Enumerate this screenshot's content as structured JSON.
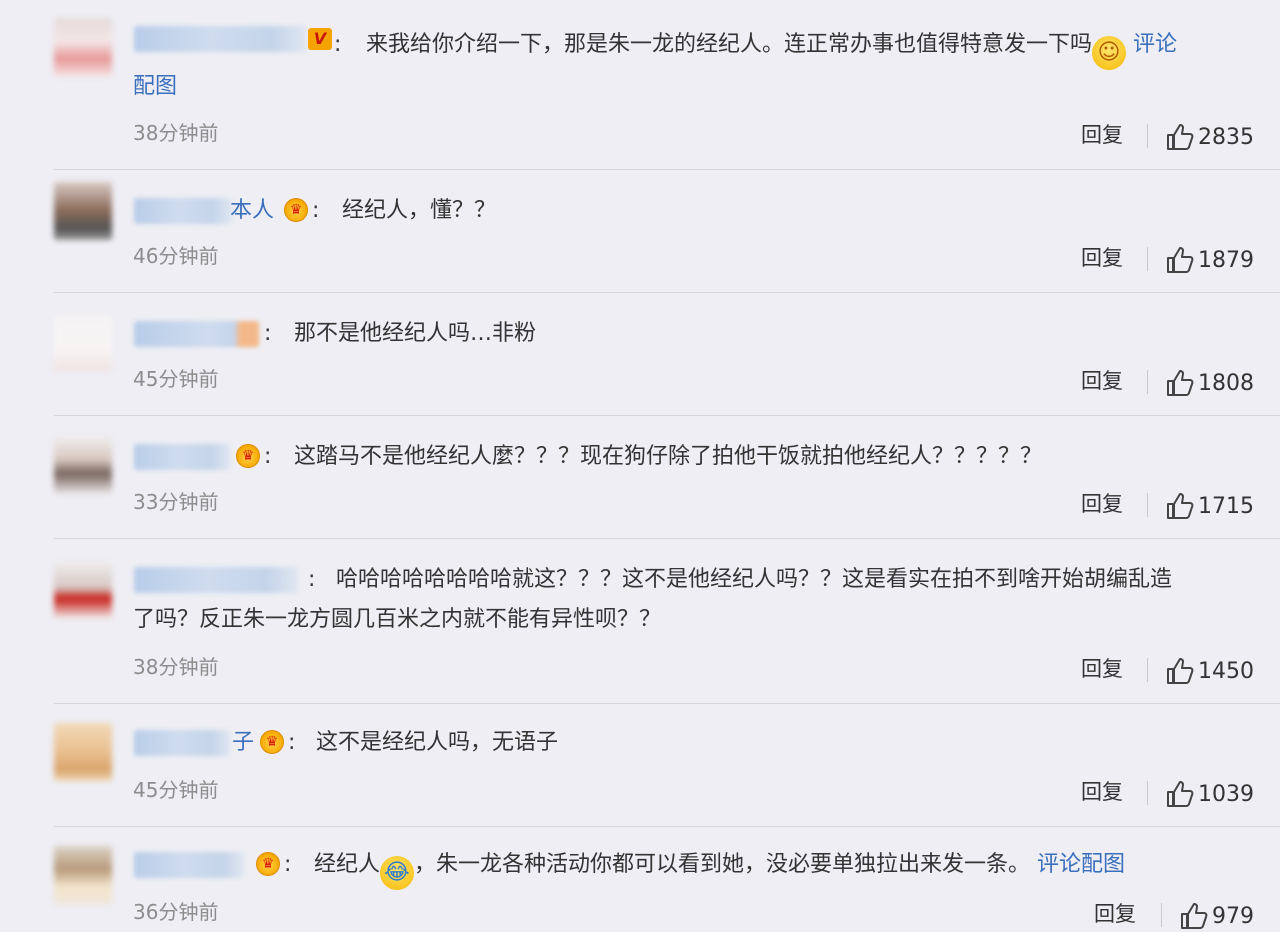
{
  "comments": [
    {
      "name_tail": "",
      "text": "来我给你介绍一下，那是朱一龙的经纪人。连正常办事也值得特意发一下吗",
      "link": "评论",
      "link2": "配图",
      "time": "38分钟前",
      "reply": "回复",
      "likes": "2835"
    },
    {
      "name_tail": "本人",
      "text": "经纪人，懂？？",
      "time": "46分钟前",
      "reply": "回复",
      "likes": "1879"
    },
    {
      "name_tail": "",
      "text": "那不是他经纪人吗…非粉",
      "time": "45分钟前",
      "reply": "回复",
      "likes": "1808"
    },
    {
      "name_tail": "",
      "text": "这踏马不是他经纪人麼？？？现在狗仔除了拍他干饭就拍他经纪人？？？？？",
      "time": "33分钟前",
      "reply": "回复",
      "likes": "1715"
    },
    {
      "name_tail": "",
      "text": "哈哈哈哈哈哈哈哈就这？？？这不是他经纪人吗？？这是看实在拍不到啥开始胡编乱造",
      "text2": "了吗？反正朱一龙方圆几百米之内就不能有异性呗？？",
      "time": "38分钟前",
      "reply": "回复",
      "likes": "1450"
    },
    {
      "name_tail": "子",
      "text": "这不是经纪人吗，无语子",
      "time": "45分钟前",
      "reply": "回复",
      "likes": "1039"
    },
    {
      "name_tail": "",
      "text_a": "经纪人",
      "text_b": "，朱一龙各种活动你都可以看到她，没必要单独拉出来发一条。",
      "link": "评论配图",
      "time": "36分钟前",
      "reply": "回复",
      "likes": "979"
    }
  ]
}
